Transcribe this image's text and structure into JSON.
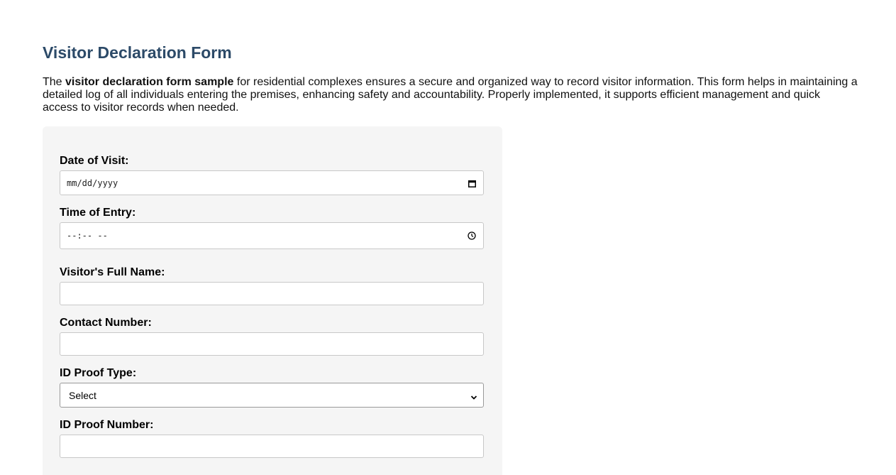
{
  "header": {
    "title": "Visitor Declaration Form"
  },
  "intro": {
    "prefix": "The ",
    "bold": "visitor declaration form sample",
    "rest": " for residential complexes ensures a secure and organized way to record visitor information. This form helps in maintaining a detailed log of all individuals entering the premises, enhancing safety and accountability. Properly implemented, it supports efficient management and quick access to visitor records when needed."
  },
  "form": {
    "date": {
      "label": "Date of Visit:",
      "placeholder": "mm/dd/yyyy",
      "icon": "calendar-icon"
    },
    "time": {
      "label": "Time of Entry:",
      "placeholder": "--:-- --",
      "icon": "clock-icon"
    },
    "name": {
      "label": "Visitor's Full Name:",
      "value": ""
    },
    "contact": {
      "label": "Contact Number:",
      "value": ""
    },
    "id_type": {
      "label": "ID Proof Type:",
      "selected": "Select",
      "icon": "chevron-down-icon"
    },
    "id_number": {
      "label": "ID Proof Number:",
      "value": ""
    }
  }
}
